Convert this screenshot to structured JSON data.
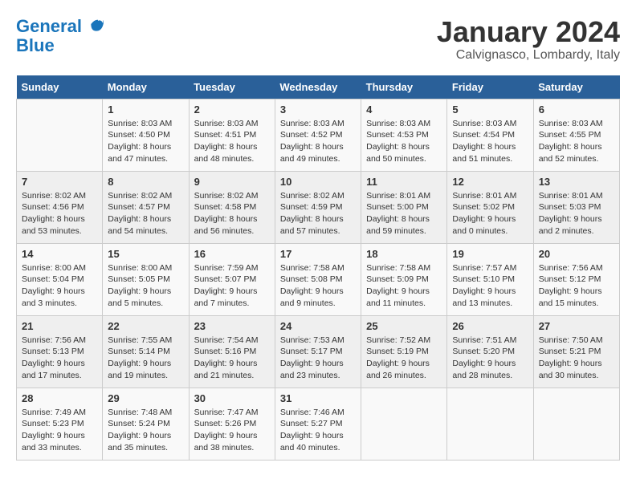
{
  "logo": {
    "line1": "General",
    "line2": "Blue"
  },
  "title": "January 2024",
  "subtitle": "Calvignasco, Lombardy, Italy",
  "days_of_week": [
    "Sunday",
    "Monday",
    "Tuesday",
    "Wednesday",
    "Thursday",
    "Friday",
    "Saturday"
  ],
  "weeks": [
    [
      {
        "day": "",
        "sunrise": "",
        "sunset": "",
        "daylight": ""
      },
      {
        "day": "1",
        "sunrise": "Sunrise: 8:03 AM",
        "sunset": "Sunset: 4:50 PM",
        "daylight": "Daylight: 8 hours and 47 minutes."
      },
      {
        "day": "2",
        "sunrise": "Sunrise: 8:03 AM",
        "sunset": "Sunset: 4:51 PM",
        "daylight": "Daylight: 8 hours and 48 minutes."
      },
      {
        "day": "3",
        "sunrise": "Sunrise: 8:03 AM",
        "sunset": "Sunset: 4:52 PM",
        "daylight": "Daylight: 8 hours and 49 minutes."
      },
      {
        "day": "4",
        "sunrise": "Sunrise: 8:03 AM",
        "sunset": "Sunset: 4:53 PM",
        "daylight": "Daylight: 8 hours and 50 minutes."
      },
      {
        "day": "5",
        "sunrise": "Sunrise: 8:03 AM",
        "sunset": "Sunset: 4:54 PM",
        "daylight": "Daylight: 8 hours and 51 minutes."
      },
      {
        "day": "6",
        "sunrise": "Sunrise: 8:03 AM",
        "sunset": "Sunset: 4:55 PM",
        "daylight": "Daylight: 8 hours and 52 minutes."
      }
    ],
    [
      {
        "day": "7",
        "sunrise": "Sunrise: 8:02 AM",
        "sunset": "Sunset: 4:56 PM",
        "daylight": "Daylight: 8 hours and 53 minutes."
      },
      {
        "day": "8",
        "sunrise": "Sunrise: 8:02 AM",
        "sunset": "Sunset: 4:57 PM",
        "daylight": "Daylight: 8 hours and 54 minutes."
      },
      {
        "day": "9",
        "sunrise": "Sunrise: 8:02 AM",
        "sunset": "Sunset: 4:58 PM",
        "daylight": "Daylight: 8 hours and 56 minutes."
      },
      {
        "day": "10",
        "sunrise": "Sunrise: 8:02 AM",
        "sunset": "Sunset: 4:59 PM",
        "daylight": "Daylight: 8 hours and 57 minutes."
      },
      {
        "day": "11",
        "sunrise": "Sunrise: 8:01 AM",
        "sunset": "Sunset: 5:00 PM",
        "daylight": "Daylight: 8 hours and 59 minutes."
      },
      {
        "day": "12",
        "sunrise": "Sunrise: 8:01 AM",
        "sunset": "Sunset: 5:02 PM",
        "daylight": "Daylight: 9 hours and 0 minutes."
      },
      {
        "day": "13",
        "sunrise": "Sunrise: 8:01 AM",
        "sunset": "Sunset: 5:03 PM",
        "daylight": "Daylight: 9 hours and 2 minutes."
      }
    ],
    [
      {
        "day": "14",
        "sunrise": "Sunrise: 8:00 AM",
        "sunset": "Sunset: 5:04 PM",
        "daylight": "Daylight: 9 hours and 3 minutes."
      },
      {
        "day": "15",
        "sunrise": "Sunrise: 8:00 AM",
        "sunset": "Sunset: 5:05 PM",
        "daylight": "Daylight: 9 hours and 5 minutes."
      },
      {
        "day": "16",
        "sunrise": "Sunrise: 7:59 AM",
        "sunset": "Sunset: 5:07 PM",
        "daylight": "Daylight: 9 hours and 7 minutes."
      },
      {
        "day": "17",
        "sunrise": "Sunrise: 7:58 AM",
        "sunset": "Sunset: 5:08 PM",
        "daylight": "Daylight: 9 hours and 9 minutes."
      },
      {
        "day": "18",
        "sunrise": "Sunrise: 7:58 AM",
        "sunset": "Sunset: 5:09 PM",
        "daylight": "Daylight: 9 hours and 11 minutes."
      },
      {
        "day": "19",
        "sunrise": "Sunrise: 7:57 AM",
        "sunset": "Sunset: 5:10 PM",
        "daylight": "Daylight: 9 hours and 13 minutes."
      },
      {
        "day": "20",
        "sunrise": "Sunrise: 7:56 AM",
        "sunset": "Sunset: 5:12 PM",
        "daylight": "Daylight: 9 hours and 15 minutes."
      }
    ],
    [
      {
        "day": "21",
        "sunrise": "Sunrise: 7:56 AM",
        "sunset": "Sunset: 5:13 PM",
        "daylight": "Daylight: 9 hours and 17 minutes."
      },
      {
        "day": "22",
        "sunrise": "Sunrise: 7:55 AM",
        "sunset": "Sunset: 5:14 PM",
        "daylight": "Daylight: 9 hours and 19 minutes."
      },
      {
        "day": "23",
        "sunrise": "Sunrise: 7:54 AM",
        "sunset": "Sunset: 5:16 PM",
        "daylight": "Daylight: 9 hours and 21 minutes."
      },
      {
        "day": "24",
        "sunrise": "Sunrise: 7:53 AM",
        "sunset": "Sunset: 5:17 PM",
        "daylight": "Daylight: 9 hours and 23 minutes."
      },
      {
        "day": "25",
        "sunrise": "Sunrise: 7:52 AM",
        "sunset": "Sunset: 5:19 PM",
        "daylight": "Daylight: 9 hours and 26 minutes."
      },
      {
        "day": "26",
        "sunrise": "Sunrise: 7:51 AM",
        "sunset": "Sunset: 5:20 PM",
        "daylight": "Daylight: 9 hours and 28 minutes."
      },
      {
        "day": "27",
        "sunrise": "Sunrise: 7:50 AM",
        "sunset": "Sunset: 5:21 PM",
        "daylight": "Daylight: 9 hours and 30 minutes."
      }
    ],
    [
      {
        "day": "28",
        "sunrise": "Sunrise: 7:49 AM",
        "sunset": "Sunset: 5:23 PM",
        "daylight": "Daylight: 9 hours and 33 minutes."
      },
      {
        "day": "29",
        "sunrise": "Sunrise: 7:48 AM",
        "sunset": "Sunset: 5:24 PM",
        "daylight": "Daylight: 9 hours and 35 minutes."
      },
      {
        "day": "30",
        "sunrise": "Sunrise: 7:47 AM",
        "sunset": "Sunset: 5:26 PM",
        "daylight": "Daylight: 9 hours and 38 minutes."
      },
      {
        "day": "31",
        "sunrise": "Sunrise: 7:46 AM",
        "sunset": "Sunset: 5:27 PM",
        "daylight": "Daylight: 9 hours and 40 minutes."
      },
      {
        "day": "",
        "sunrise": "",
        "sunset": "",
        "daylight": ""
      },
      {
        "day": "",
        "sunrise": "",
        "sunset": "",
        "daylight": ""
      },
      {
        "day": "",
        "sunrise": "",
        "sunset": "",
        "daylight": ""
      }
    ]
  ]
}
